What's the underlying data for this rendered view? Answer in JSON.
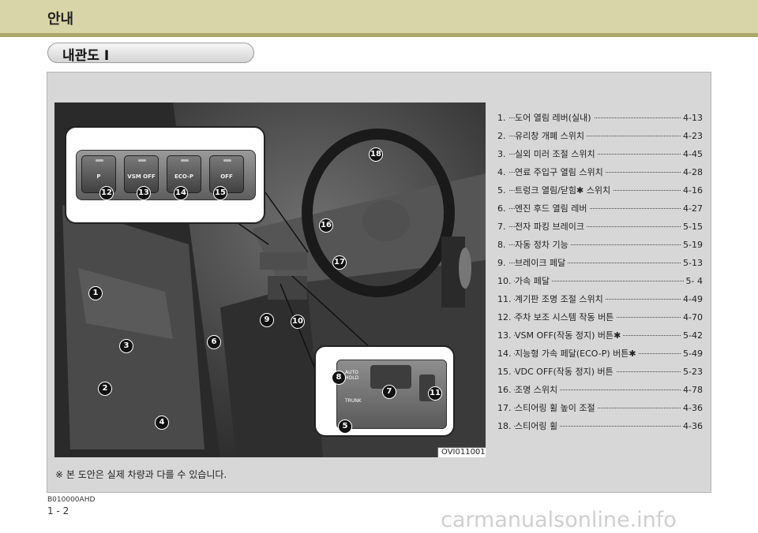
{
  "header": {
    "title": "안내"
  },
  "section": {
    "title": "내관도 I"
  },
  "photo": {
    "code": "OVI011001"
  },
  "callouts": [
    "1",
    "2",
    "3",
    "4",
    "5",
    "6",
    "7",
    "8",
    "9",
    "10",
    "11",
    "12",
    "13",
    "14",
    "15",
    "16",
    "17",
    "18"
  ],
  "switches": [
    {
      "label": "P",
      "icon": "parking-sensor-icon"
    },
    {
      "label": "VSM OFF",
      "icon": ""
    },
    {
      "label": "ECO-P",
      "icon": ""
    },
    {
      "label": "OFF",
      "icon": "stability-off-icon"
    }
  ],
  "console_labels": {
    "auto_hold": "AUTO HOLD",
    "trunk": "TRUNK"
  },
  "items": [
    {
      "num": "1.",
      "label": "도어 열림 레버(실내)",
      "page": "4-13"
    },
    {
      "num": "2.",
      "label": "유리창 개폐 스위치",
      "page": "4-23"
    },
    {
      "num": "3.",
      "label": "실외 미러 조절 스위치",
      "page": "4-45"
    },
    {
      "num": "4.",
      "label": "연료 주입구 열림 스위치",
      "page": "4-28"
    },
    {
      "num": "5.",
      "label": "트렁크 열림/닫힘✱ 스위치",
      "page": "4-16"
    },
    {
      "num": "6.",
      "label": "엔진 후드 열림 레버",
      "page": "4-27"
    },
    {
      "num": "7.",
      "label": "전자 파킹 브레이크",
      "page": "5-15"
    },
    {
      "num": "8.",
      "label": "자동 정차 기능",
      "page": "5-19"
    },
    {
      "num": "9.",
      "label": "브레이크 페달",
      "page": "5-13"
    },
    {
      "num": "10.",
      "label": "가속 페달",
      "page": "5- 4"
    },
    {
      "num": "11.",
      "label": "계기판 조명 조절 스위치",
      "page": "4-49"
    },
    {
      "num": "12.",
      "label": "주차 보조 시스템 작동 버튼",
      "page": "4-70"
    },
    {
      "num": "13.",
      "label": "VSM OFF(작동 정지) 버튼✱",
      "page": "5-42"
    },
    {
      "num": "14.",
      "label": "지능형 가속 페달(ECO-P) 버튼✱",
      "page": "5-49"
    },
    {
      "num": "15.",
      "label": "VDC OFF(작동 정지) 버튼",
      "page": "5-23"
    },
    {
      "num": "16.",
      "label": "조명 스위치",
      "page": "4-78"
    },
    {
      "num": "17.",
      "label": "스티어링 휠 높이 조절",
      "page": "4-36"
    },
    {
      "num": "18.",
      "label": "스티어링 휠",
      "page": "4-36"
    }
  ],
  "note": "※ 본 도안은 실제 차량과 다를 수 있습니다.",
  "doc_code": "B010000AHD",
  "page_number": "1 - 2",
  "watermark": "carmanualsonline.info"
}
